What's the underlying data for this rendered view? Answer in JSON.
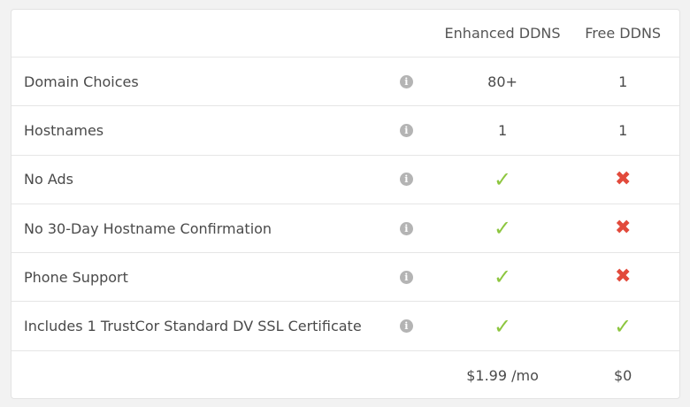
{
  "header": {
    "enhanced_label": "Enhanced DDNS",
    "free_label": "Free DDNS"
  },
  "features": [
    {
      "label": "Domain Choices",
      "enhanced": "80+",
      "free": "1"
    },
    {
      "label": "Hostnames",
      "enhanced": "1",
      "free": "1"
    },
    {
      "label": "No Ads",
      "enhanced": "check",
      "free": "cross"
    },
    {
      "label": "No 30-Day Hostname Confirmation",
      "enhanced": "check",
      "free": "cross"
    },
    {
      "label": "Phone Support",
      "enhanced": "check",
      "free": "cross"
    },
    {
      "label": "Includes 1 TrustCor Standard DV SSL Certificate",
      "enhanced": "check",
      "free": "check"
    }
  ],
  "pricing": {
    "enhanced_price": "$1.99 /mo",
    "free_price": "$0"
  },
  "icons": {
    "info": "info-icon",
    "check": "check-icon",
    "cross": "cross-icon"
  },
  "colors": {
    "check": "#8dc63f",
    "cross": "#e24a3b",
    "info": "#b4b4b4"
  }
}
